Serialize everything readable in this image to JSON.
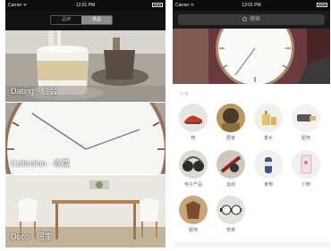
{
  "status_bar": {
    "carrier": "Carrier ᯤ",
    "time": "12:01 PM"
  },
  "left": {
    "segmented": [
      "品牌",
      "单品"
    ],
    "categories": [
      {
        "label": "Dating · 约会"
      },
      {
        "label": "Collection · 收藏"
      },
      {
        "label": "Deco · 居家"
      }
    ]
  },
  "right": {
    "search_placeholder": "搜索",
    "section_title": "分类",
    "grid": [
      "鞋",
      "居家",
      "香水",
      "配饰",
      "电子产品",
      "运动",
      "食物",
      "小物",
      "服饰",
      "表类"
    ]
  },
  "colors": {
    "status_bar": "#0c0c0c",
    "navbar": "#121212",
    "search_bg": "#3a3a3a"
  }
}
